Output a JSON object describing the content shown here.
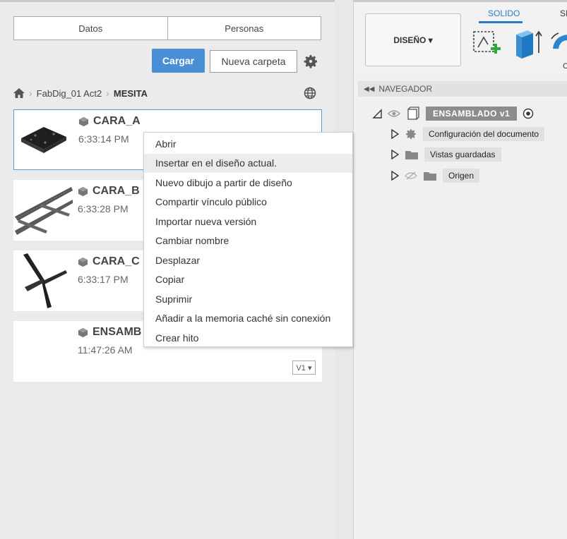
{
  "tabs": [
    "Datos",
    "Personas"
  ],
  "actions": {
    "upload": "Cargar",
    "new_folder": "Nueva carpeta"
  },
  "breadcrumb": {
    "project": "FabDig_01 Act2",
    "folder": "MESITA"
  },
  "files": [
    {
      "name": "CARA_A",
      "time": "6:33:14 PM"
    },
    {
      "name": "CARA_B",
      "time": "6:33:28 PM"
    },
    {
      "name": "CARA_C",
      "time": "6:33:17 PM"
    },
    {
      "name": "ENSAMB",
      "time": "11:47:26 AM",
      "version": "V1 ▾"
    }
  ],
  "context_menu": [
    "Abrir",
    "Insertar en el diseño actual.",
    "Nuevo dibujo a partir de diseño",
    "Compartir vínculo público",
    "Importar nueva versión",
    "Cambiar nombre",
    "Desplazar",
    "Copiar",
    "Suprimir",
    "Añadir a la memoria caché sin conexión",
    "Crear hito"
  ],
  "toolbar": {
    "design": "DISEÑO ▾",
    "tab_active": "SOLIDO",
    "tab_next": "SI",
    "tool_label_partial": "C"
  },
  "navigator": {
    "title": "NAVEGADOR",
    "root": "ENSAMBLADO v1",
    "nodes": [
      "Configuración del documento",
      "Vistas guardadas",
      "Origen"
    ]
  },
  "colors": {
    "accent": "#4a8fd6",
    "selection_border": "#5b9bd5",
    "tab_active": "#2a7ac7"
  }
}
